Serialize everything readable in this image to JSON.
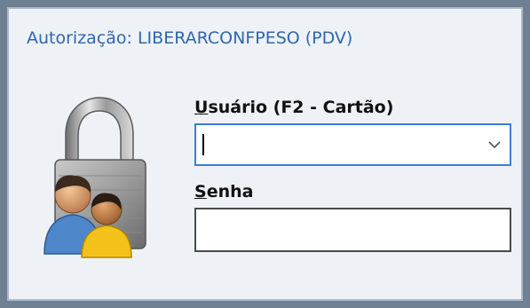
{
  "dialog": {
    "title": "Autorização: LIBERARCONFPESO (PDV)",
    "icon": "padlock-users-icon"
  },
  "user_field": {
    "label_accel": "U",
    "label_rest": "suário (F2 - Cartão)",
    "value": "",
    "icon": "chevron-down-icon"
  },
  "password_field": {
    "label_accel": "S",
    "label_rest": "enha",
    "value": ""
  },
  "colors": {
    "title": "#2f66b0",
    "frame": "#6f7f94",
    "panel": "#eef2f7",
    "focus_border": "#3a7fd5"
  }
}
